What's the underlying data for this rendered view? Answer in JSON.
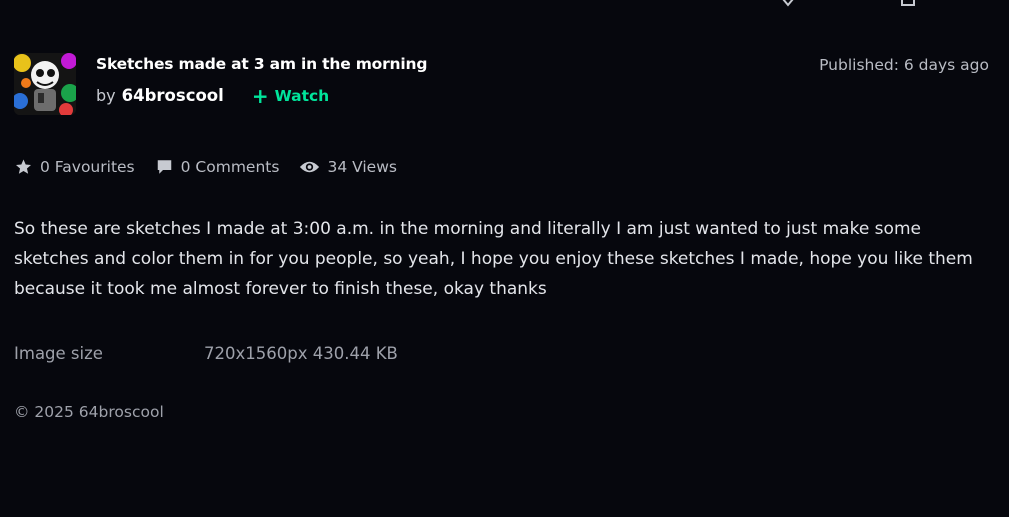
{
  "deviation": {
    "title": "Sketches made at 3 am in the morning",
    "by_label": "by",
    "author": "64broscool",
    "watch_label": "Watch",
    "published": "Published: 6 days ago"
  },
  "stats": {
    "favourites": "0 Favourites",
    "comments": "0 Comments",
    "views": "34 Views"
  },
  "description": "So these are sketches I made at 3:00 a.m. in the morning and literally I am just wanted to just make some sketches and color them in for you people, so yeah, I hope you enjoy these sketches I made, hope you like them because it took me almost forever to finish these, okay thanks",
  "details": {
    "image_size_label": "Image size",
    "image_size_value": "720x1560px 430.44 KB"
  },
  "copyright": "© 2025 64broscool",
  "colors": {
    "background": "#06070d",
    "accent_watch": "#00e59b"
  },
  "icons": {
    "favourite": "star-icon",
    "comments": "speech-bubble-icon",
    "views": "eye-icon",
    "watch": "plus-icon"
  }
}
